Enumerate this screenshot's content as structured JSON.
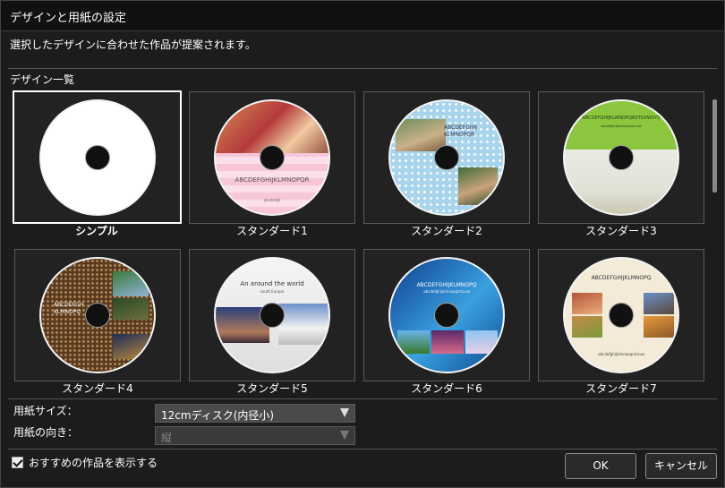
{
  "window": {
    "title": "デザインと用紙の設定"
  },
  "description": "選択したデザインに合わせた作品が提案されます。",
  "design_list": {
    "title": "デザイン一覧",
    "items": [
      {
        "label": "シンプル",
        "selected": true,
        "disc_text": [
          "",
          ""
        ]
      },
      {
        "label": "スタンダード1",
        "selected": false,
        "disc_text": [
          "ABCDEFGHIJKLMNOPQR",
          "abcdefgh"
        ]
      },
      {
        "label": "スタンダード2",
        "selected": false,
        "disc_text": [
          "ABCDEFGHIJ",
          "KLMNOPQR"
        ]
      },
      {
        "label": "スタンダード3",
        "selected": false,
        "disc_text": [
          "ABCDEFGHIJKLMNOPQRSTUVWXYZ",
          "abcdefghijklmnopqrstuvw"
        ]
      },
      {
        "label": "スタンダード4",
        "selected": false,
        "disc_text": [
          "ABCDEFGH",
          "KLMNOPQ"
        ]
      },
      {
        "label": "スタンダード5",
        "selected": false,
        "disc_text": [
          "An around the world",
          "south Europe"
        ]
      },
      {
        "label": "スタンダード6",
        "selected": false,
        "disc_text": [
          "ABCDEFGHIJKLMNOPQ",
          "abcdefghijklmnopqrstuvw"
        ]
      },
      {
        "label": "スタンダード7",
        "selected": false,
        "disc_text": [
          "ABCDEFGHIJKLMNOPQ",
          "abcdefghijklmnopqrstuvw"
        ]
      }
    ]
  },
  "paper_size": {
    "label": "用紙サイズ：",
    "value": "12cmディスク(内径小)"
  },
  "orientation": {
    "label": "用紙の向き：",
    "value": "縦"
  },
  "recommend": {
    "label": "おすすめの作品を表示する",
    "checked": true
  },
  "buttons": {
    "ok": "OK",
    "cancel": "キャンセル"
  },
  "colors": {
    "background": "#1c1c1c",
    "accent_green": "#8cc63f",
    "brown": "#5a3a1e",
    "sky_blue": "#1e6fb8"
  }
}
